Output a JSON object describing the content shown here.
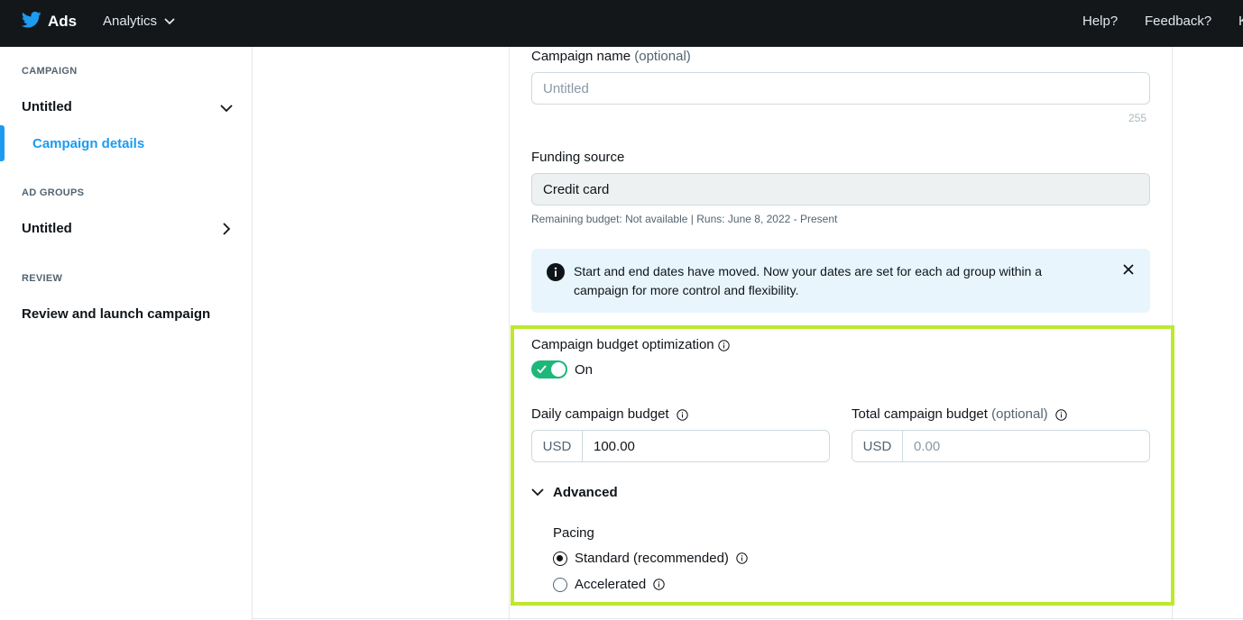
{
  "topbar": {
    "brand": "Ads",
    "analytics": "Analytics",
    "help": "Help?",
    "feedback": "Feedback?",
    "cut_text": "K"
  },
  "sidebar": {
    "campaign_label": "CAMPAIGN",
    "campaign_name": "Untitled",
    "campaign_details": "Campaign details",
    "adgroups_label": "AD GROUPS",
    "adgroup_name": "Untitled",
    "review_label": "REVIEW",
    "review_item": "Review and launch campaign"
  },
  "form": {
    "campaign_name_label": "Campaign name",
    "campaign_name_optional": "(optional)",
    "campaign_name_placeholder": "Untitled",
    "campaign_name_counter": "255",
    "funding_label": "Funding source",
    "funding_value": "Credit card",
    "funding_subtext": "Remaining budget: Not available | Runs: June 8, 2022 - Present",
    "notice_text": "Start and end dates have moved. Now your dates are set for each ad group within a campaign for more control and flexibility.",
    "cbo_label": "Campaign budget optimization",
    "cbo_state": "On",
    "daily_label": "Daily campaign budget",
    "daily_currency": "USD",
    "daily_value": "100.00",
    "total_label": "Total campaign budget",
    "total_optional": "(optional)",
    "total_currency": "USD",
    "total_placeholder": "0.00",
    "advanced_label": "Advanced",
    "pacing_label": "Pacing",
    "pacing_standard": "Standard (recommended)",
    "pacing_accelerated": "Accelerated"
  }
}
